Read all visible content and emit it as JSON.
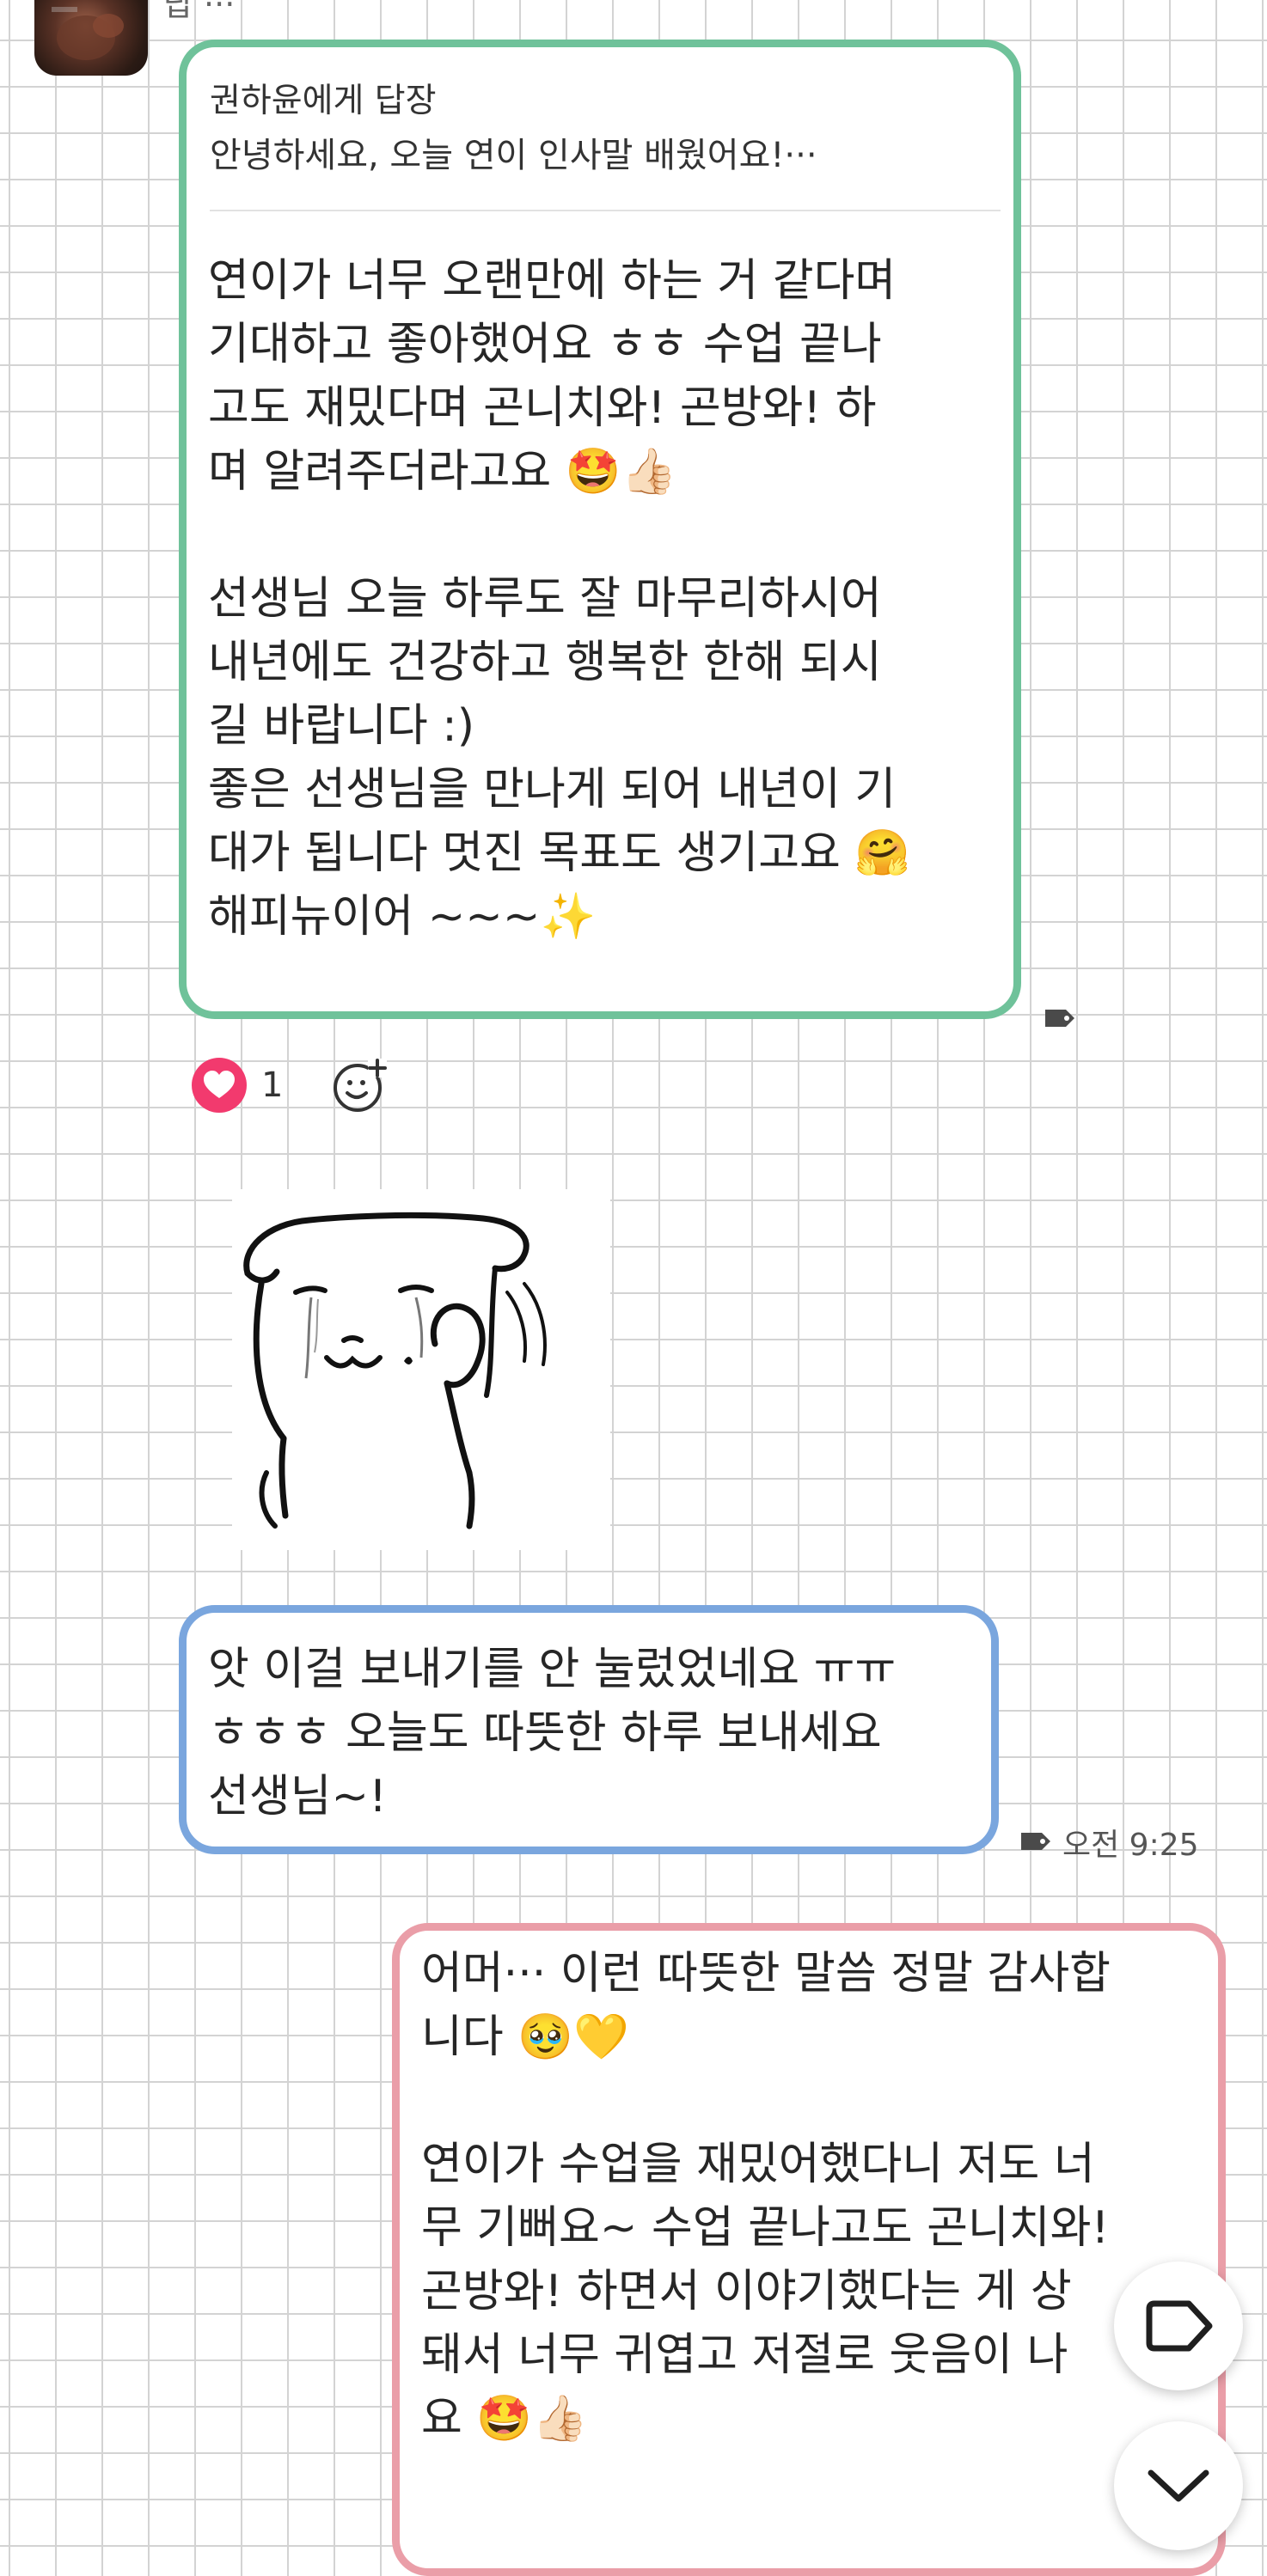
{
  "sender": {
    "name_fragment": "답 ···",
    "avatar_icon": "profile-photo"
  },
  "message_1": {
    "reply_to_label": "권하윤에게 답장",
    "reply_quote": "안녕하세요, 오늘 연이 인사말 배웠어요!···",
    "text": "연이가 너무 오랜만에 하는 거 같다며\n기대하고 좋아했어요 ㅎㅎ 수업 끝나\n고도 재밌다며 곤니치와! 곤방와! 하\n며 알려주더라고요 🤩👍🏻\n\n선생님 오늘 하루도 잘 마무리하시어\n내년에도 건강하고 행복한 한해 되시\n길 바랍니다 :)\n좋은 선생님을 만나게 되어 내년이 기\n대가 됩니다 멋진 목표도 생기고요 🤗\n해피뉴이어 ~~~✨",
    "border_color": "#6fc29a",
    "reactions": {
      "heart_count": "1",
      "heart_icon": "heart-filled",
      "add_reaction_icon": "add-emoji"
    }
  },
  "sticker": {
    "description_icon": "crying-dog-sticker"
  },
  "message_2": {
    "text": "앗 이걸 보내기를 안 눌렀었네요 ㅠㅠ\nㅎㅎㅎ 오늘도 따뜻한 하루 보내세요\n선생님~!",
    "time": "오전 9:25",
    "border_color": "#7aa6de"
  },
  "message_3": {
    "text": "어머··· 이런 따뜻한 말씀 정말 감사합\n니다 🥹💛\n\n연이가 수업을 재밌어했다니 저도 너\n무 기뻐요~ 수업 끝나고도 곤니치와!\n곤방와! 하면서 이야기했다는 게 상\n돼서 너무 귀엽고 저절로 웃음이 나\n요 🤩👍🏻",
    "border_color": "#ea9ea8"
  },
  "fabs": {
    "tag_icon": "tag-outline",
    "scroll_icon": "chevron-down"
  }
}
